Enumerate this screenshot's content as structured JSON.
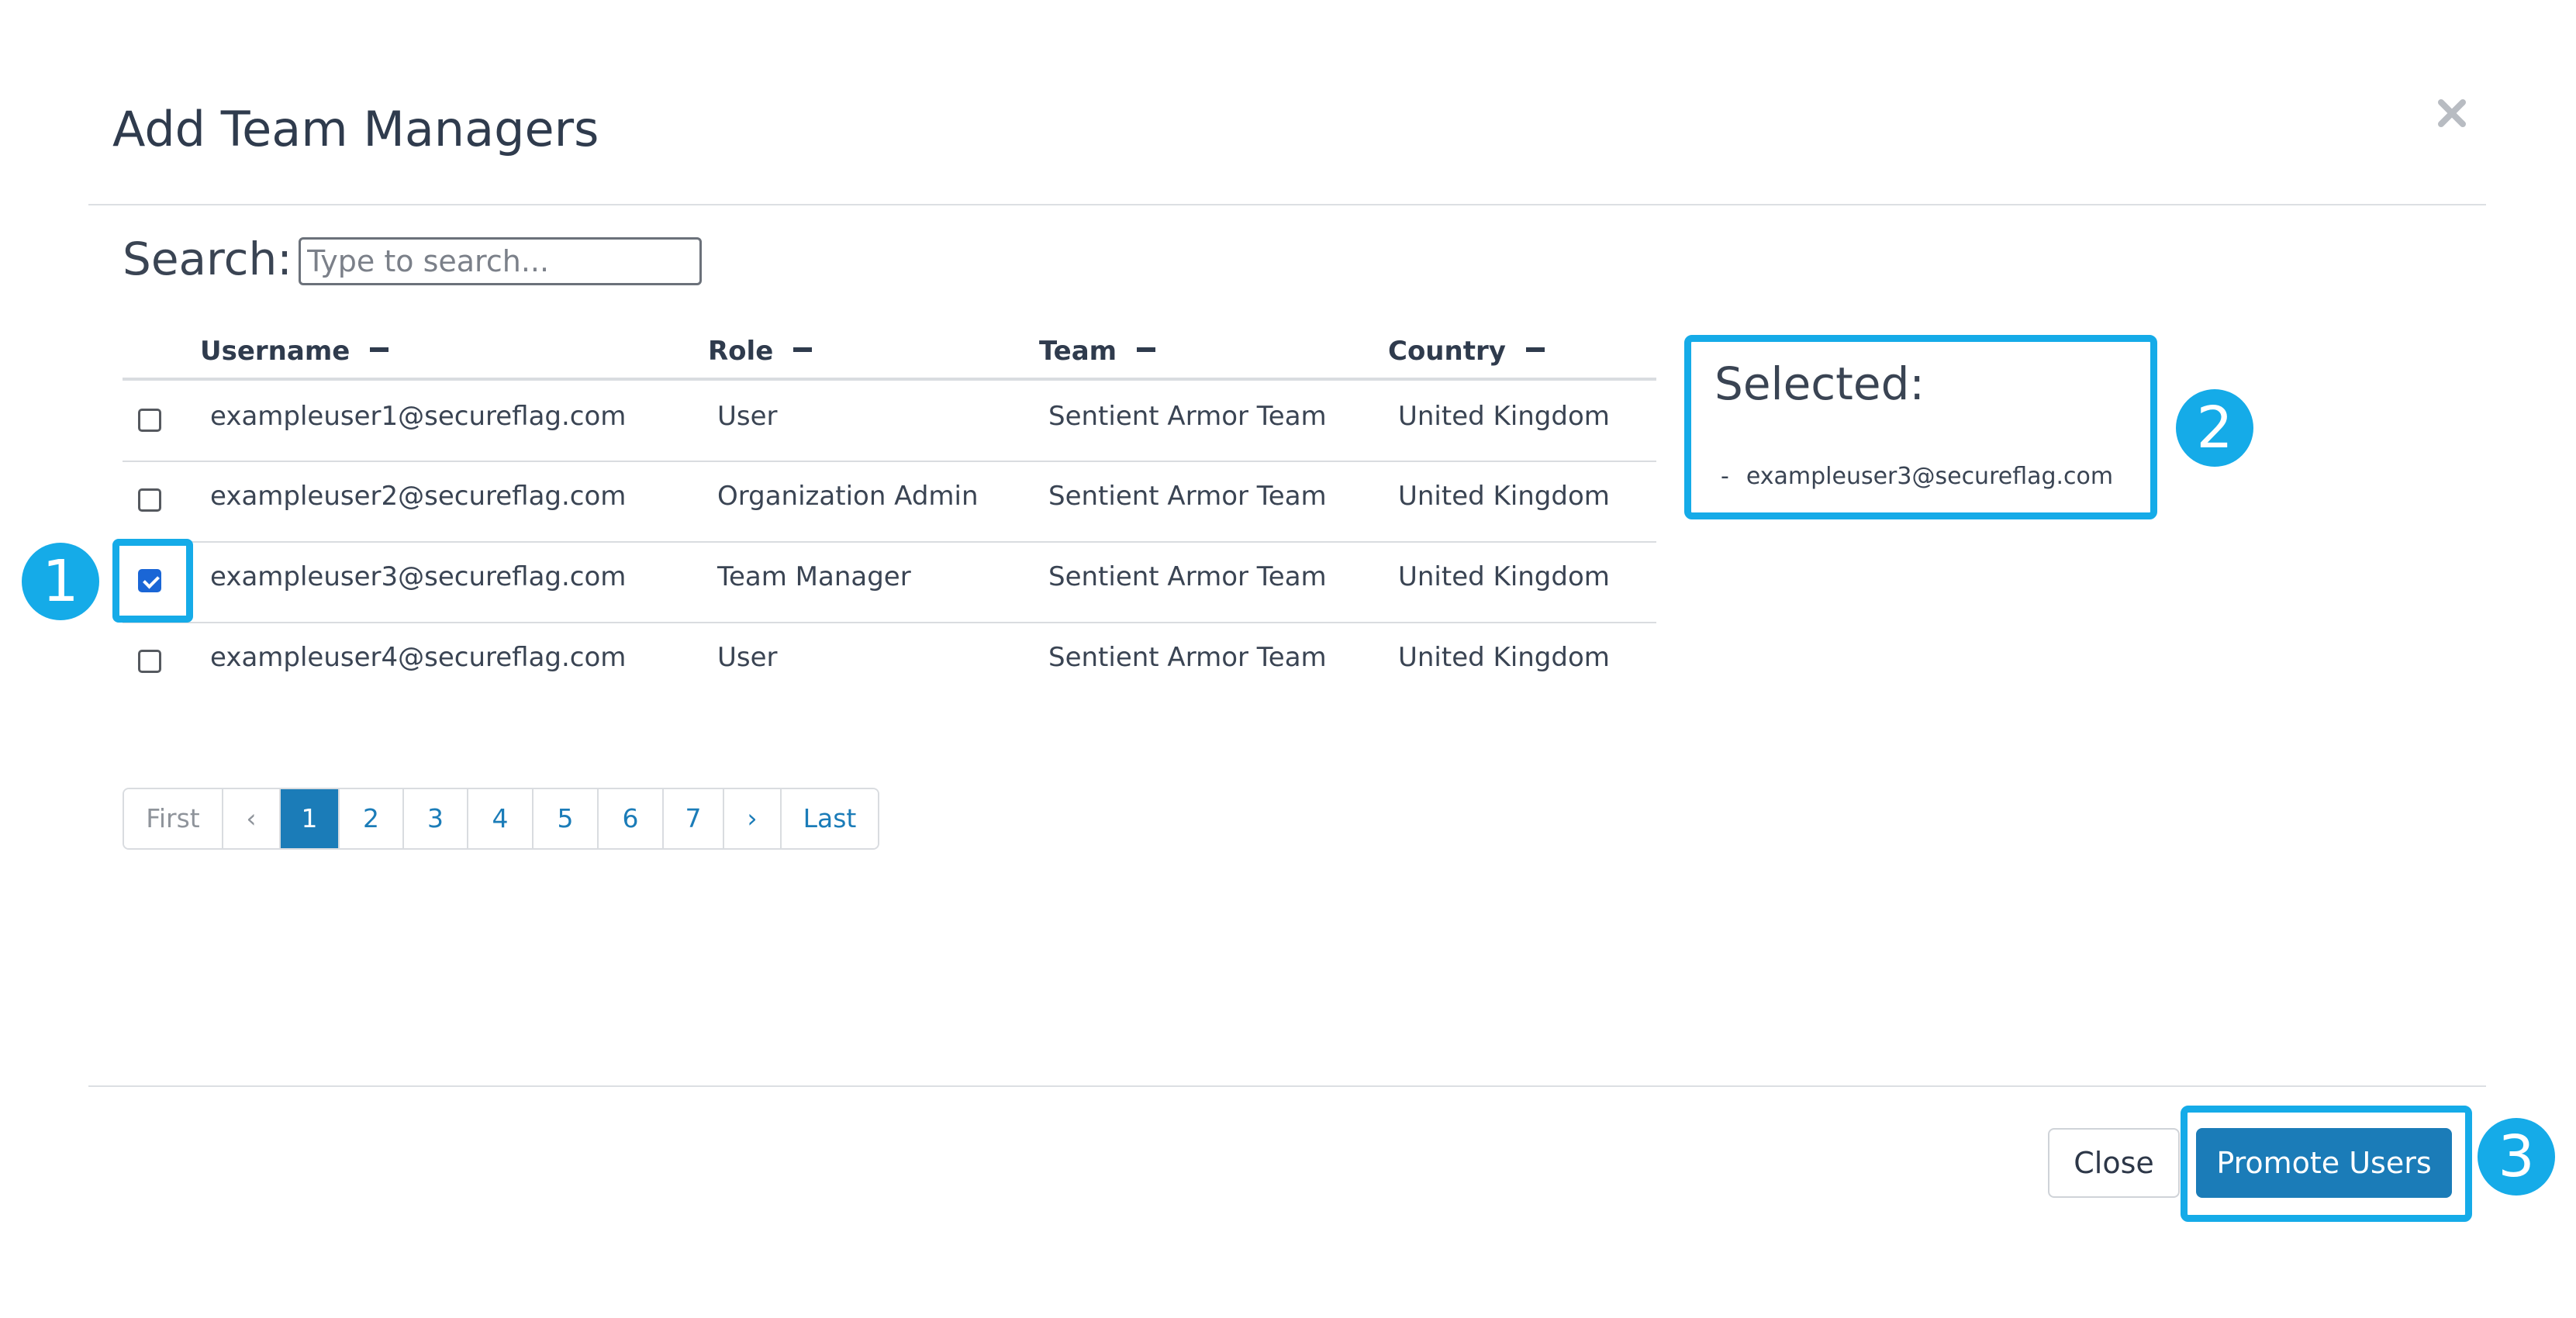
{
  "modal": {
    "title": "Add Team Managers"
  },
  "search": {
    "label": "Search:",
    "placeholder": "Type to search..."
  },
  "table": {
    "columns": [
      "Username",
      "Role",
      "Team",
      "Country"
    ],
    "rows": [
      {
        "username": "exampleuser1@secureflag.com",
        "role": "User",
        "team": "Sentient Armor Team",
        "country": "United Kingdom",
        "checked": false
      },
      {
        "username": "exampleuser2@secureflag.com",
        "role": "Organization Admin",
        "team": "Sentient Armor Team",
        "country": "United Kingdom",
        "checked": false
      },
      {
        "username": "exampleuser3@secureflag.com",
        "role": "Team Manager",
        "team": "Sentient Armor Team",
        "country": "United Kingdom",
        "checked": true
      },
      {
        "username": "exampleuser4@secureflag.com",
        "role": "User",
        "team": "Sentient Armor Team",
        "country": "United Kingdom",
        "checked": false
      }
    ]
  },
  "selected": {
    "title": "Selected:",
    "dash": "-",
    "items": [
      "exampleuser3@secureflag.com"
    ]
  },
  "pagination": {
    "first": "First",
    "prev": "‹",
    "pages": [
      "1",
      "2",
      "3",
      "4",
      "5",
      "6",
      "7"
    ],
    "active_page": "1",
    "next": "›",
    "last": "Last"
  },
  "footer": {
    "close_label": "Close",
    "promote_label": "Promote Users"
  },
  "annotations": [
    "1",
    "2",
    "3"
  ],
  "colors": {
    "primary": "#1b7cb8",
    "highlight": "#15abe8",
    "checkbox_checked": "#1a66d6",
    "text": "#2f3b4d"
  }
}
